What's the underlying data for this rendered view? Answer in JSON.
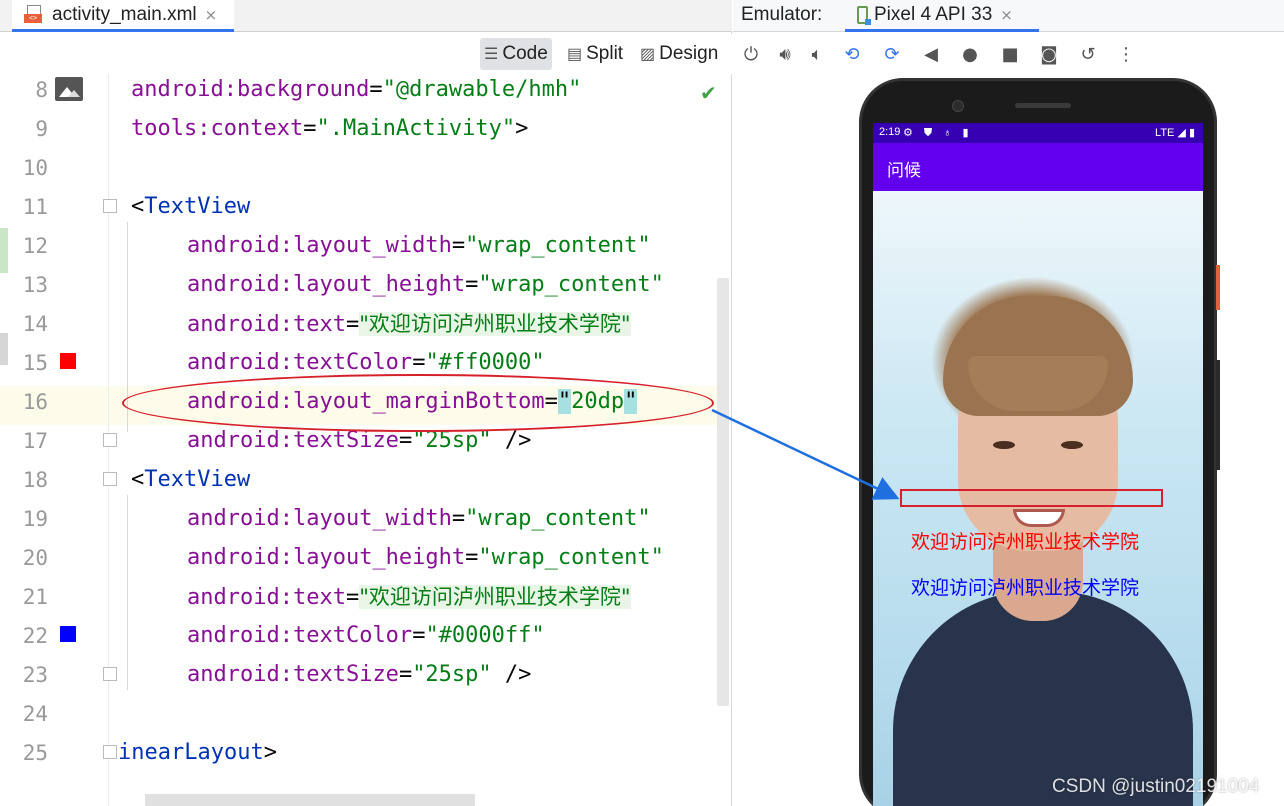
{
  "editor": {
    "file_tab": {
      "title": "activity_main.xml",
      "close": "×",
      "icon_text": "<>"
    },
    "view_modes": {
      "code": "Code",
      "split": "Split",
      "design": "Design"
    },
    "lines": [
      {
        "num": "8",
        "tokens": [
          [
            "ns",
            "android:"
          ],
          [
            "attr",
            "background"
          ],
          [
            "plain",
            "="
          ],
          [
            "val",
            "\"@drawable/hmh\""
          ]
        ]
      },
      {
        "num": "9",
        "tokens": [
          [
            "ns",
            "tools:"
          ],
          [
            "attr",
            "context"
          ],
          [
            "plain",
            "="
          ],
          [
            "val",
            "\".MainActivity\""
          ],
          [
            "plain",
            ">"
          ]
        ]
      },
      {
        "num": "10",
        "tokens": []
      },
      {
        "num": "11",
        "tokens": [
          [
            "plain",
            "<"
          ],
          [
            "tag",
            "TextView"
          ]
        ]
      },
      {
        "num": "12",
        "tokens": [
          [
            "ns",
            "android:"
          ],
          [
            "attr",
            "layout_width"
          ],
          [
            "plain",
            "="
          ],
          [
            "val",
            "\"wrap_content\""
          ]
        ]
      },
      {
        "num": "13",
        "tokens": [
          [
            "ns",
            "android:"
          ],
          [
            "attr",
            "layout_height"
          ],
          [
            "plain",
            "="
          ],
          [
            "val",
            "\"wrap_content\""
          ]
        ]
      },
      {
        "num": "14",
        "tokens": [
          [
            "ns",
            "android:"
          ],
          [
            "attr",
            "text"
          ],
          [
            "plain",
            "="
          ],
          [
            "hl",
            "\"欢迎访问泸州职业技术学院\""
          ]
        ]
      },
      {
        "num": "15",
        "tokens": [
          [
            "ns",
            "android:"
          ],
          [
            "attr",
            "textColor"
          ],
          [
            "plain",
            "="
          ],
          [
            "val",
            "\"#ff0000\""
          ]
        ]
      },
      {
        "num": "16",
        "tokens": [
          [
            "ns",
            "android:"
          ],
          [
            "attr",
            "layout_marginBottom"
          ],
          [
            "plain",
            "="
          ],
          [
            "sel",
            "\""
          ],
          [
            "val",
            "20dp"
          ],
          [
            "sel",
            "\""
          ]
        ]
      },
      {
        "num": "17",
        "tokens": [
          [
            "ns",
            "android:"
          ],
          [
            "attr",
            "textSize"
          ],
          [
            "plain",
            "="
          ],
          [
            "val",
            "\"25sp\""
          ],
          [
            "plain",
            " />"
          ]
        ]
      },
      {
        "num": "18",
        "tokens": [
          [
            "plain",
            "<"
          ],
          [
            "tag",
            "TextView"
          ]
        ]
      },
      {
        "num": "19",
        "tokens": [
          [
            "ns",
            "android:"
          ],
          [
            "attr",
            "layout_width"
          ],
          [
            "plain",
            "="
          ],
          [
            "val",
            "\"wrap_content\""
          ]
        ]
      },
      {
        "num": "20",
        "tokens": [
          [
            "ns",
            "android:"
          ],
          [
            "attr",
            "layout_height"
          ],
          [
            "plain",
            "="
          ],
          [
            "val",
            "\"wrap_content\""
          ]
        ]
      },
      {
        "num": "21",
        "tokens": [
          [
            "ns",
            "android:"
          ],
          [
            "attr",
            "text"
          ],
          [
            "plain",
            "="
          ],
          [
            "hl",
            "\"欢迎访问泸州职业技术学院\""
          ]
        ]
      },
      {
        "num": "22",
        "tokens": [
          [
            "ns",
            "android:"
          ],
          [
            "attr",
            "textColor"
          ],
          [
            "plain",
            "="
          ],
          [
            "val",
            "\"#0000ff\""
          ]
        ]
      },
      {
        "num": "23",
        "tokens": [
          [
            "ns",
            "android:"
          ],
          [
            "attr",
            "textSize"
          ],
          [
            "plain",
            "="
          ],
          [
            "val",
            "\"25sp\""
          ],
          [
            "plain",
            " />"
          ]
        ]
      },
      {
        "num": "24",
        "tokens": []
      },
      {
        "num": "25",
        "tokens": [
          [
            "tag",
            "inearLayout"
          ],
          [
            "plain",
            ">"
          ]
        ]
      }
    ],
    "swatches": {
      "line15": "#ff0000",
      "line22": "#0000ff"
    }
  },
  "emulator": {
    "label": "Emulator:",
    "device_tab": {
      "title": "Pixel 4 API 33",
      "close": "×"
    },
    "toolbar_icons": [
      "power-icon",
      "volume-up-icon",
      "volume-down-icon",
      "rotate-left-icon",
      "rotate-right-icon",
      "back-icon",
      "home-icon",
      "overview-icon",
      "screenshot-icon",
      "snapshot-icon",
      "more-icon"
    ],
    "status": {
      "time": "2:19",
      "icons": "⚙ ⛊ ♁ ▮",
      "right": "LTE ◢ ▮"
    },
    "app_title": "问候",
    "text_view_1": {
      "text": "欢迎访问泸州职业技术学院",
      "color": "#ff0000"
    },
    "text_view_2": {
      "text": "欢迎访问泸州职业技术学院",
      "color": "#0000ff"
    }
  },
  "watermark": "CSDN @justin02191004"
}
